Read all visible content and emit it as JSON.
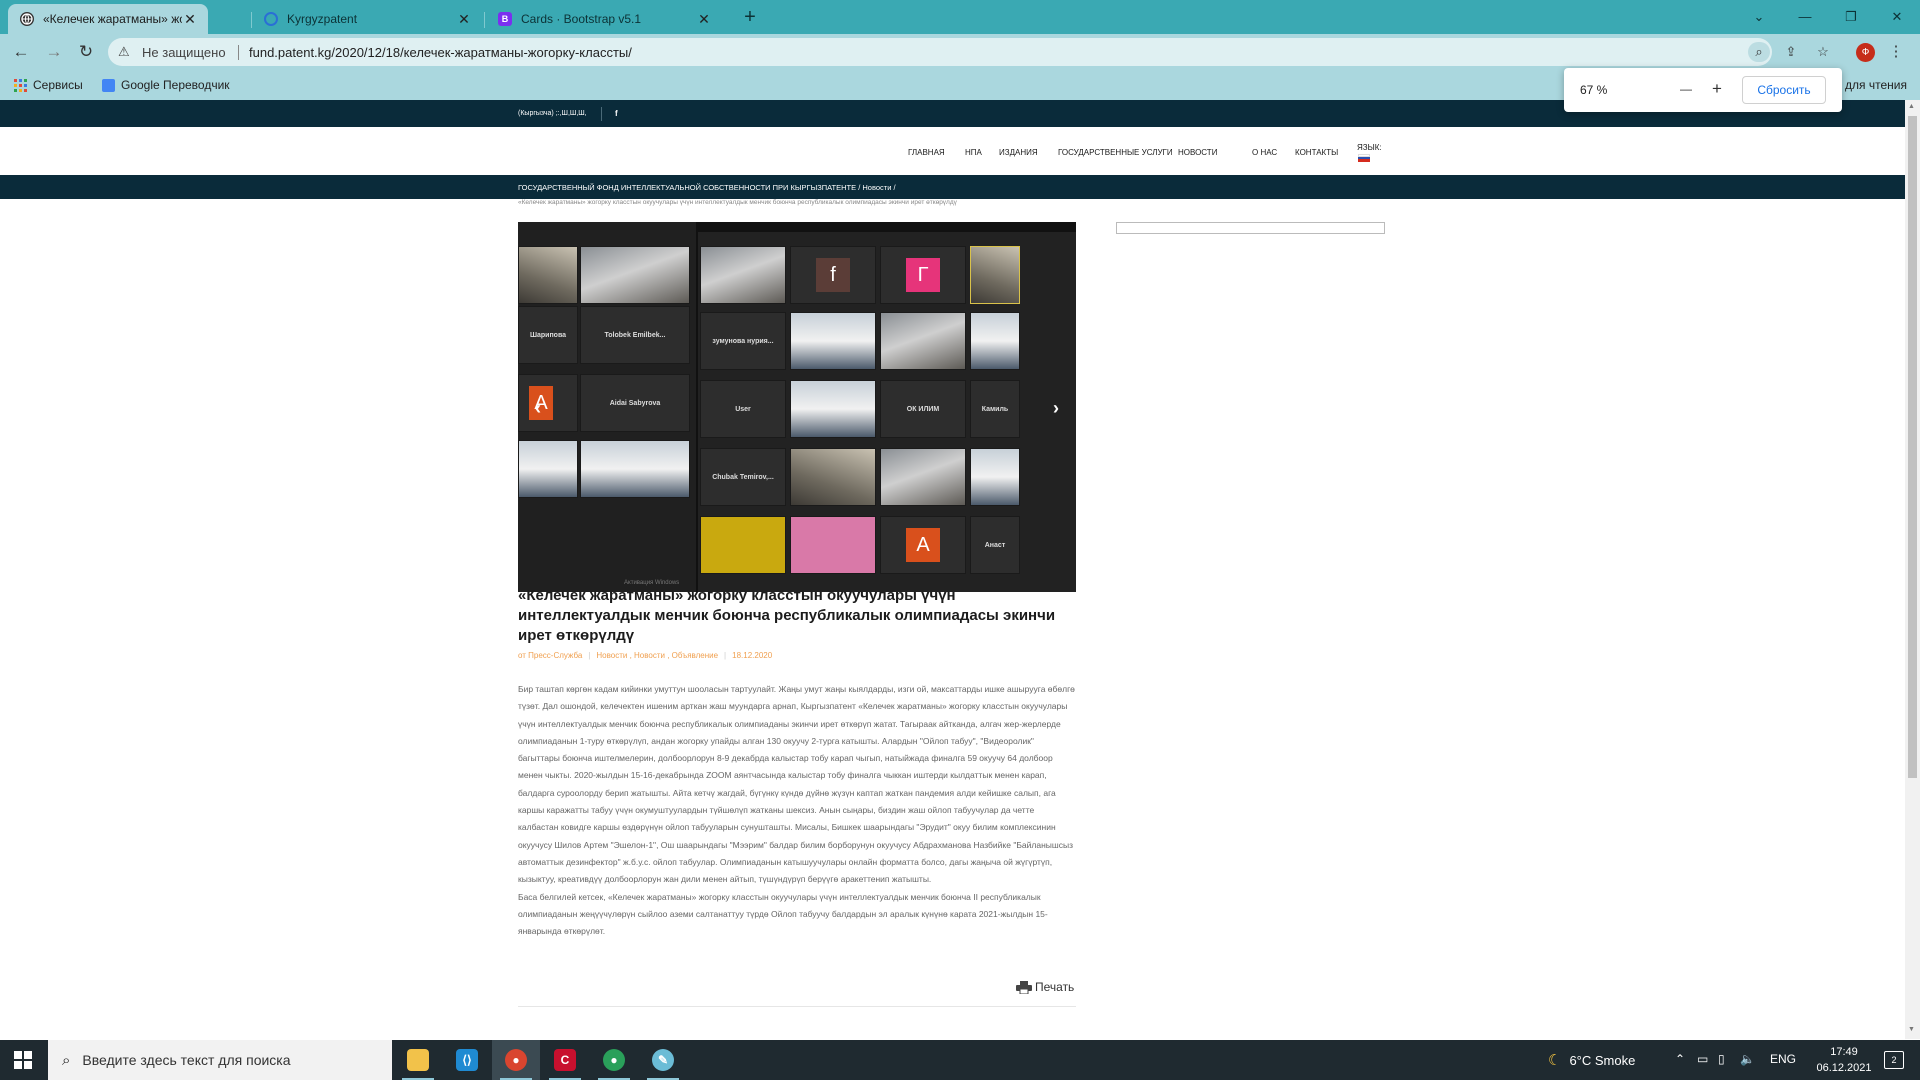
{
  "browser": {
    "tabs": [
      {
        "title": "«Келечек жаратманы» жогорку",
        "favicon": "globe-icon",
        "active": true
      },
      {
        "title": "Kyrgyzpatent",
        "favicon": "loading-ring-icon",
        "active": false
      },
      {
        "title": "Cards · Bootstrap v5.1",
        "favicon": "bootstrap-icon",
        "active": false,
        "favicon_letter": "B"
      }
    ],
    "new_tab": "+",
    "address": {
      "security_label": "Не защищено",
      "url": "fund.patent.kg/2020/12/18/келечек-жаратманы-жогорку-классты/"
    },
    "profile_initial": "Ф",
    "bookmarks": [
      {
        "label": "Сервисы",
        "icon": "apps-grid-icon"
      },
      {
        "label": "Google Переводчик",
        "icon": "google-translate-icon"
      }
    ],
    "reading_list": "для чтения",
    "zoom_popup": {
      "percent": "67 %",
      "minus": "—",
      "plus": "+",
      "reset_label": "Сбросить"
    }
  },
  "site": {
    "topbar": {
      "lang_text": "(Кыргызча) ;:,Ш,Ш,Ш,",
      "facebook": "f"
    },
    "nav": [
      "ГЛАВНАЯ",
      "НПА",
      "ИЗДАНИЯ",
      "ГОСУДАРСТВЕННЫЕ УСЛУГИ",
      "НОВОСТИ",
      "О НАС",
      "КОНТАКТЫ"
    ],
    "lang_label": "ЯЗЫК:",
    "breadcrumb": "ГОСУДАРСТВЕННЫЙ ФОНД ИНТЕЛЛЕКТУАЛЬНОЙ СОБСТВЕННОСТИ ПРИ КЫРГЫЗПАТЕНТЕ  /  Новости  /",
    "breadcrumb_tail": "«Келечек жаратманы» жогорку класстын окуучулары үчүн интеллектуалдык менчик боюнча республикалык олимпиадасы экинчи ирет өткөрүлдү"
  },
  "slider": {
    "left_tiles": [
      "Шарипова",
      "Tolobek Emilbek...",
      "Aidai Sabyrova",
      "A"
    ],
    "right_tiles": [
      "f",
      "Г",
      "зумунова нурия...",
      "User",
      "ОК ИЛИМ",
      "Chubak Temirov,...",
      "A",
      "Камиль",
      "Анаст"
    ],
    "watermark": "Активация Windows"
  },
  "article": {
    "title": "«Келечек жаратманы» жогорку класстын окуучулары үчүн интеллектуалдык менчик боюнча республикалык олимпиадасы экинчи ирет өткөрүлдү",
    "author": "от Пресс-Служба",
    "categories": "Новости , Новости , Объявление",
    "date": "18.12.2020",
    "paragraphs": [
      "Бир таштап көргөн кадам кийинки умуттун шооласын тартуулайт. Жаңы умут жаңы кыялдарды, изги ой, максаттарды ишке ашырууга өбөлгө түзөт. Дал ошондой, келечектен ишеним арткан жаш муундарга арнап, Кыргызпатент «Келечек жаратманы» жогорку класстын окуучулары үчүн интеллектуалдык менчик боюнча республикалык олимпиаданы экинчи ирет өткөрүп жатат. Тагыраак айтканда, алгач жер-жерлерде олимпиаданын 1-туру өткөрүлүп, андан жогорку упайды алган 130 окуучу 2-турга катышты. Алардын \"Ойлоп табуу\", \"Видеоролик\" багыттары боюнча иштелмелерин, долбоорлорун 8-9 декабрда калыстар тобу карап чыгып, натыйжада финалга 59 окуучу 64 долбоор менен чыкты. 2020-жылдын 15-16-декабрында ZOOM аянтчасында калыстар тобу финалга чыккан иштерди кылдаттык менен карап, балдарга суроолорду берип жатышты. Айта кетчү жагдай, бүгүнкү күндө дүйнө жүзүн каптап жаткан пандемия алди кейишке салып, ага каршы каражатты табуу үчүн окумуштуулардын түйшөлүп жатканы шексиз. Анын сыңары, биздин жаш ойлоп табуучулар да четте калбастан ковидге каршы өздөрүнүн ойлоп табууларын сунушташты. Мисалы, Бишкек шаарындагы \"Эрудит\" окуу билим комплексинин окуучусу Шилов Артем \"Эшелон-1\", Ош шаарындагы \"Мээрим\" балдар билим борборунун окуучусу Абдрахманова Назбийке \"Байланышсыз автоматтык дезинфектор\" ж.б.у.с. ойлоп табуулар. Олимпиаданын катышуучулары онлайн форматта болсо, дагы жаңыча ой жүгүртүп, кызыктуу, креативдүү долбоорлорун жан дили менен айтып, түшүндүрүп берүүгө аракеттенип жатышты.",
      "Баса белгилей кетсек, «Келечек жаратманы» жогорку класстын окуучулары үчүн интеллектуалдык менчик боюнча II республикалык олимпиаданын жеңүүчүлөрүн сыйлоо аземи салтанаттуу түрдө Ойлоп табуучу балдардын эл аралык күнүнө карата 2021-жылдын 15-январында өткөрүлөт."
    ],
    "print_label": "Печать"
  },
  "taskbar": {
    "search_placeholder": "Введите здесь текст для поиска",
    "apps": [
      {
        "name": "file-explorer-icon",
        "color": "#f2c24a"
      },
      {
        "name": "vscode-icon",
        "color": "#1f8ad2"
      },
      {
        "name": "chrome-icon",
        "color": "#d9452f"
      },
      {
        "name": "red-app-icon",
        "color": "#c8102e"
      },
      {
        "name": "chrome-profile-icon",
        "color": "#2aa05a"
      },
      {
        "name": "paint-icon",
        "color": "#6bbcd6"
      }
    ],
    "weather": "6°C  Smoke",
    "lang": "ENG",
    "time": "17:49",
    "date": "06.12.2021",
    "notifications": "2"
  }
}
